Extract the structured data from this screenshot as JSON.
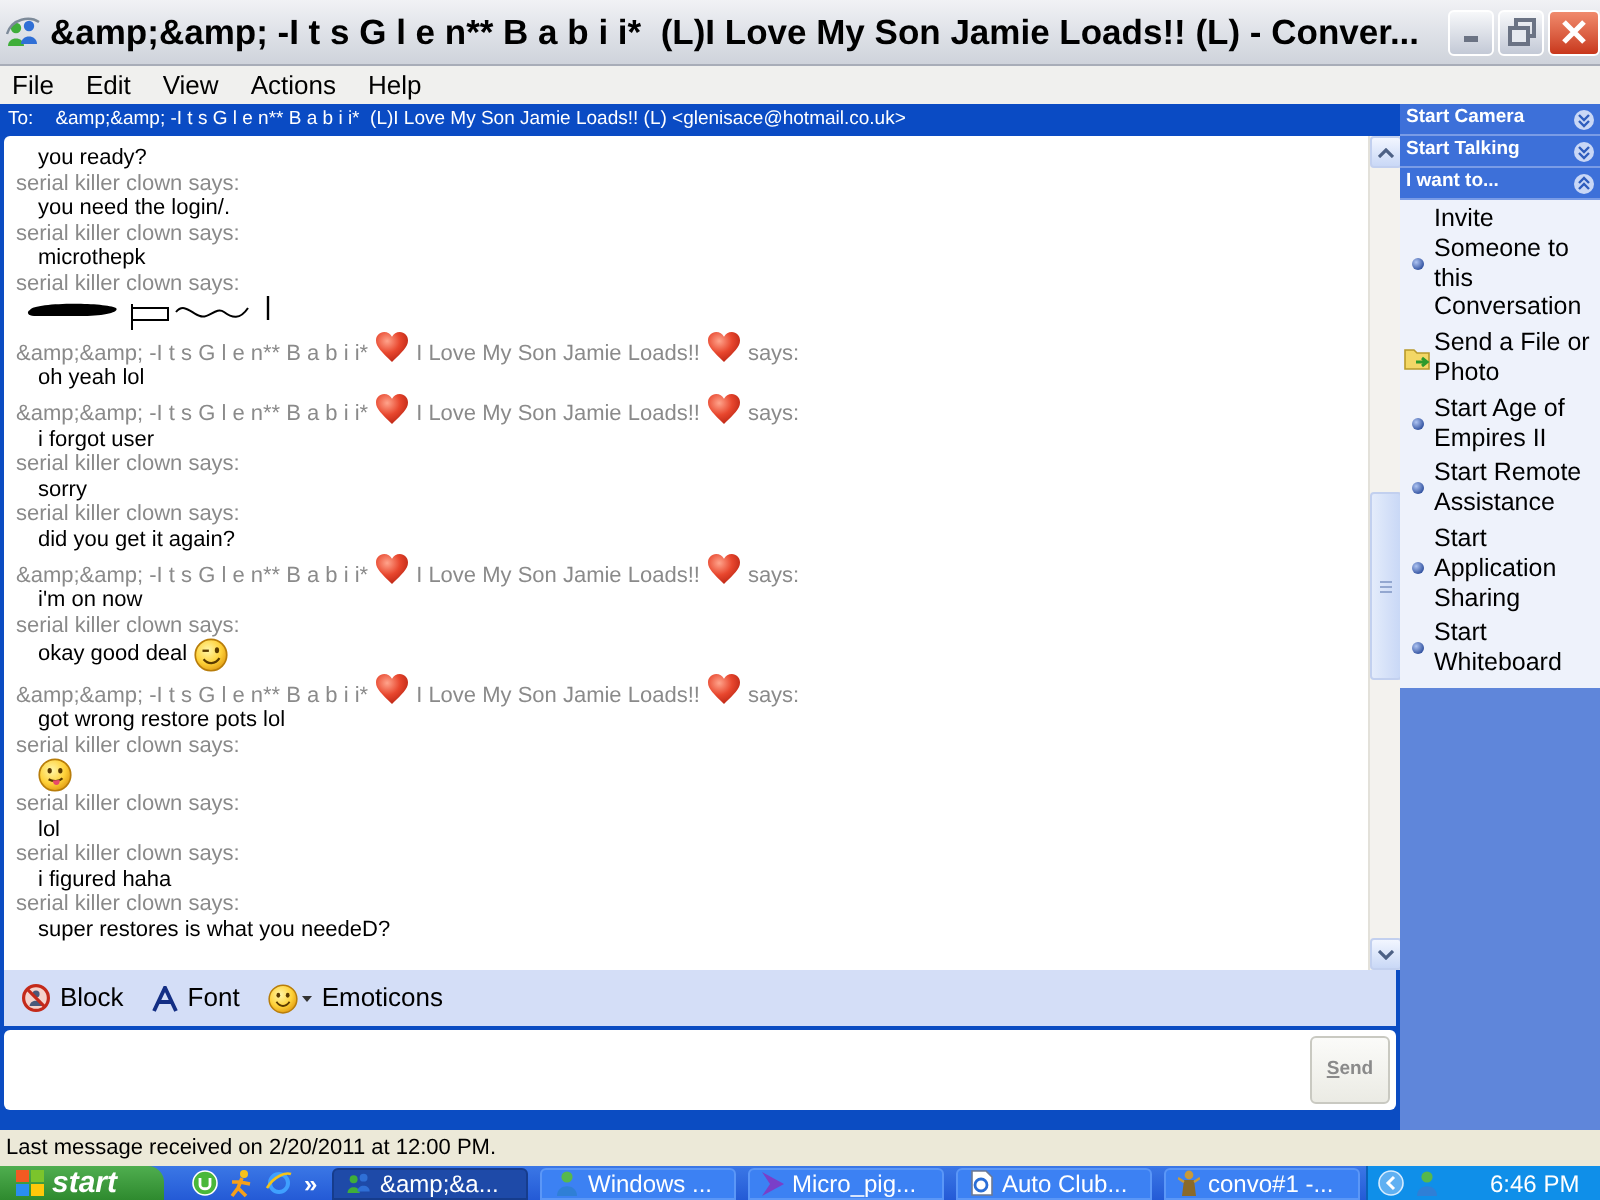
{
  "window": {
    "title": "&amp;&amp; -I t s G l e n** B a b i i*  (L)I Love My Son Jamie Loads!! (L) - Conver...",
    "menu": [
      "File",
      "Edit",
      "View",
      "Actions",
      "Help"
    ]
  },
  "to_bar": {
    "label": "To:",
    "recipient": "&amp;&amp; -I t s G l e n** B a b i i*  (L)I Love My Son Jamie Loads!! (L) <glenisace@hotmail.co.uk>"
  },
  "conversation": [
    {
      "kind": "message",
      "segments": [
        {
          "kind": "text",
          "text": "you ready?"
        }
      ]
    },
    {
      "kind": "sender",
      "segments": [
        {
          "kind": "text",
          "text": "serial killer clown says:"
        }
      ]
    },
    {
      "kind": "message",
      "segments": [
        {
          "kind": "text",
          "text": "you need the login/."
        }
      ]
    },
    {
      "kind": "sender",
      "segments": [
        {
          "kind": "text",
          "text": "serial killer clown says:"
        }
      ]
    },
    {
      "kind": "message",
      "segments": [
        {
          "kind": "text",
          "text": "microthepk"
        }
      ]
    },
    {
      "kind": "sender",
      "segments": [
        {
          "kind": "text",
          "text": "serial killer clown says:"
        }
      ]
    },
    {
      "kind": "ink"
    },
    {
      "kind": "sender",
      "segments": [
        {
          "kind": "text",
          "text": "&amp;&amp; -I t s G l e n** B a b i i*"
        },
        {
          "kind": "heart"
        },
        {
          "kind": "text",
          "text": "I Love My Son Jamie Loads!!"
        },
        {
          "kind": "heart"
        },
        {
          "kind": "text",
          "text": "says:"
        }
      ]
    },
    {
      "kind": "message",
      "segments": [
        {
          "kind": "text",
          "text": "oh yeah lol"
        }
      ]
    },
    {
      "kind": "sender",
      "segments": [
        {
          "kind": "text",
          "text": "&amp;&amp; -I t s G l e n** B a b i i*"
        },
        {
          "kind": "heart"
        },
        {
          "kind": "text",
          "text": "I Love My Son Jamie Loads!!"
        },
        {
          "kind": "heart"
        },
        {
          "kind": "text",
          "text": "says:"
        }
      ]
    },
    {
      "kind": "message",
      "segments": [
        {
          "kind": "text",
          "text": "i forgot user"
        }
      ]
    },
    {
      "kind": "sender",
      "segments": [
        {
          "kind": "text",
          "text": "serial killer clown says:"
        }
      ]
    },
    {
      "kind": "message",
      "segments": [
        {
          "kind": "text",
          "text": "sorry"
        }
      ]
    },
    {
      "kind": "sender",
      "segments": [
        {
          "kind": "text",
          "text": "serial killer clown says:"
        }
      ]
    },
    {
      "kind": "message",
      "segments": [
        {
          "kind": "text",
          "text": "did you get it again?"
        }
      ]
    },
    {
      "kind": "sender",
      "segments": [
        {
          "kind": "text",
          "text": "&amp;&amp; -I t s G l e n** B a b i i*"
        },
        {
          "kind": "heart"
        },
        {
          "kind": "text",
          "text": "I Love My Son Jamie Loads!!"
        },
        {
          "kind": "heart"
        },
        {
          "kind": "text",
          "text": "says:"
        }
      ]
    },
    {
      "kind": "message",
      "segments": [
        {
          "kind": "text",
          "text": "i'm on now"
        }
      ]
    },
    {
      "kind": "sender",
      "segments": [
        {
          "kind": "text",
          "text": "serial killer clown says:"
        }
      ]
    },
    {
      "kind": "message",
      "segments": [
        {
          "kind": "text",
          "text": "okay good deal"
        },
        {
          "kind": "wink"
        }
      ]
    },
    {
      "kind": "sender",
      "segments": [
        {
          "kind": "text",
          "text": "&amp;&amp; -I t s G l e n** B a b i i*"
        },
        {
          "kind": "heart"
        },
        {
          "kind": "text",
          "text": "I Love My Son Jamie Loads!!"
        },
        {
          "kind": "heart"
        },
        {
          "kind": "text",
          "text": "says:"
        }
      ]
    },
    {
      "kind": "message",
      "segments": [
        {
          "kind": "text",
          "text": "got wrong restore pots lol"
        }
      ]
    },
    {
      "kind": "sender",
      "segments": [
        {
          "kind": "text",
          "text": "serial killer clown says:"
        }
      ]
    },
    {
      "kind": "message",
      "segments": [
        {
          "kind": "tongue"
        }
      ]
    },
    {
      "kind": "sender",
      "segments": [
        {
          "kind": "text",
          "text": "serial killer clown says:"
        }
      ]
    },
    {
      "kind": "message",
      "segments": [
        {
          "kind": "text",
          "text": "lol"
        }
      ]
    },
    {
      "kind": "sender",
      "segments": [
        {
          "kind": "text",
          "text": "serial killer clown says:"
        }
      ]
    },
    {
      "kind": "message",
      "segments": [
        {
          "kind": "text",
          "text": "i figured haha"
        }
      ]
    },
    {
      "kind": "sender",
      "segments": [
        {
          "kind": "text",
          "text": "serial killer clown says:"
        }
      ]
    },
    {
      "kind": "message",
      "segments": [
        {
          "kind": "text",
          "text": "super restores is what you needeD?"
        }
      ]
    }
  ],
  "toolbar": [
    {
      "kind": "block",
      "label": "Block"
    },
    {
      "kind": "font",
      "label": "Font"
    },
    {
      "kind": "emoticons",
      "label": "Emoticons"
    }
  ],
  "compose": {
    "send": {
      "label": "Send",
      "disabled": true
    }
  },
  "side_panel": [
    {
      "title": "Start Camera",
      "expanded": false
    },
    {
      "title": "Start Talking",
      "expanded": false
    },
    {
      "title": "I want to...",
      "expanded": true,
      "items": [
        {
          "kind": "bullet",
          "label": "Invite Someone to this Conversation"
        },
        {
          "kind": "folder",
          "label": "Send a File or Photo"
        },
        {
          "kind": "bullet",
          "label": "Start Age of Empires II"
        },
        {
          "kind": "bullet",
          "label": "Start Remote Assistance"
        },
        {
          "kind": "bullet",
          "label": "Start Application Sharing"
        },
        {
          "kind": "bullet",
          "label": "Start Whiteboard"
        }
      ]
    }
  ],
  "status_bar": "Last message received on 2/20/2011 at 12:00 PM.",
  "taskbar": {
    "start": "start",
    "overflow": "»",
    "tasks": [
      {
        "kind": "messenger",
        "label": "&amp;&a...",
        "selected": true
      },
      {
        "kind": "person",
        "label": "Windows ...",
        "selected": false
      },
      {
        "kind": "arrow",
        "label": "Micro_pig...",
        "selected": false
      },
      {
        "kind": "web-page",
        "label": "Auto Club...",
        "selected": false
      },
      {
        "kind": "figure",
        "label": "convo#1 -...",
        "selected": false
      }
    ],
    "clock": "6:46 PM"
  }
}
